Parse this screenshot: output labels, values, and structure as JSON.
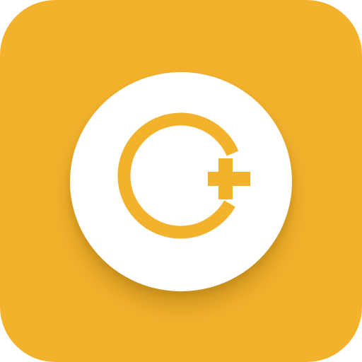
{
  "icon": {
    "name": "medical-plus-app-icon",
    "glyph": "ring-with-plus-icon"
  },
  "colors": {
    "tile_background": "#F3B22C",
    "disc": "#FFFFFF",
    "glyph": "#F3B22C"
  }
}
